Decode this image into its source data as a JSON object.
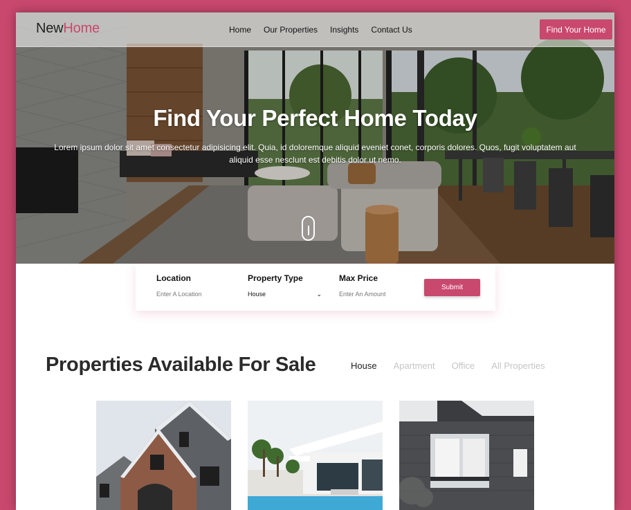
{
  "header": {
    "logo": {
      "part1": "New",
      "part2": "Home"
    },
    "nav": [
      "Home",
      "Our Properties",
      "Insights",
      "Contact Us"
    ],
    "cta_label": "Find Your Home"
  },
  "hero": {
    "title": "Find Your Perfect Home Today",
    "subtitle": "Lorem ipsum dolor sit amet consectetur adipisicing elit. Quia, id doloremque aliquid eveniet conet, corporis dolores. Quos, fugit voluptatem aut aliquid esse nesclunt est debitis dolor ut nemo."
  },
  "search": {
    "location": {
      "label": "Location",
      "placeholder": "Enter A Location"
    },
    "property_type": {
      "label": "Property Type",
      "selected": "House"
    },
    "max_price": {
      "label": "Max Price",
      "placeholder": "Enter An Amount"
    },
    "submit_label": "Submit"
  },
  "properties": {
    "title": "Properties Available For Sale",
    "tabs": [
      {
        "label": "House",
        "active": true
      },
      {
        "label": "Apartment",
        "active": false
      },
      {
        "label": "Office",
        "active": false
      },
      {
        "label": "All Properties",
        "active": false
      }
    ]
  },
  "colors": {
    "accent": "#c9486e",
    "background": "#c9486e",
    "text": "#2b2b2b",
    "muted_tab": "#c5c5c5"
  },
  "icons": [
    "scroll-mouse-icon",
    "chevron-down-icon"
  ]
}
